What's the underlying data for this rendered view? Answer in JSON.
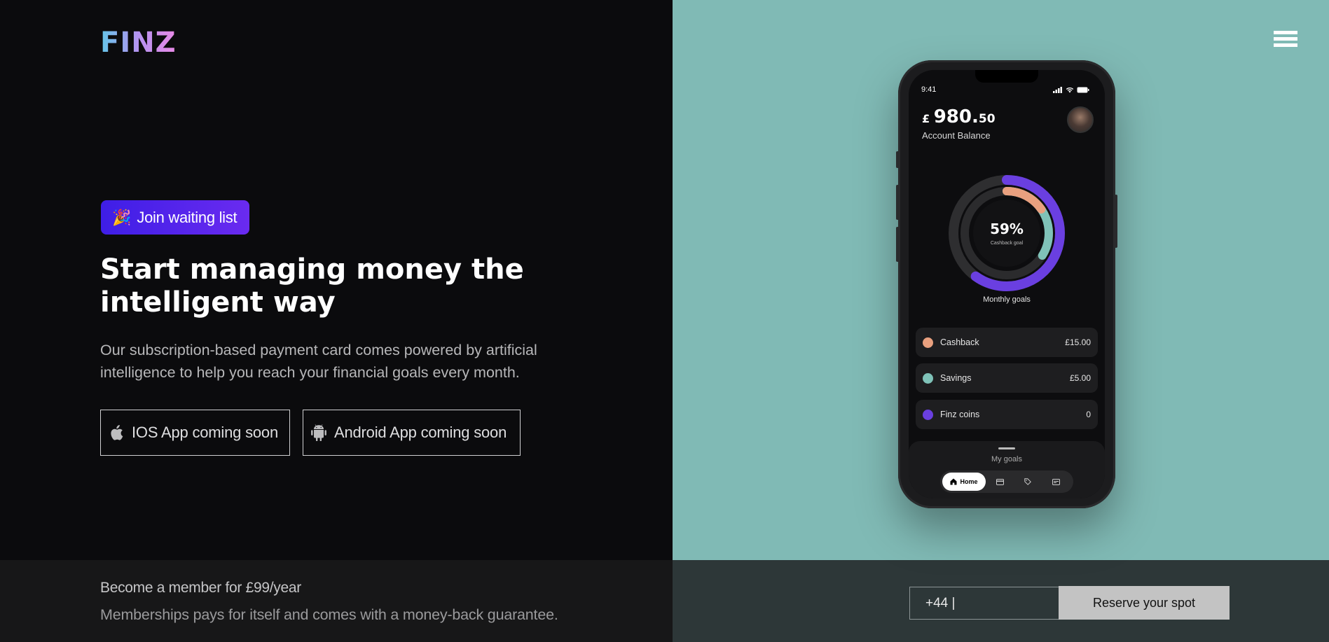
{
  "header": {
    "logo_text": "FINZ",
    "menu_icon": "hamburger-menu-icon"
  },
  "hero": {
    "waitlist_icon": "party-popper-icon",
    "waitlist_emoji": "🎉",
    "waitlist_label": "Join waiting list",
    "title": "Start managing money the intelligent way",
    "subtitle": "Our subscription-based payment card comes powered by artificial intelligence to help you reach your financial goals every month.",
    "ios_button": {
      "icon": "apple-icon",
      "label": "IOS App coming soon"
    },
    "android_button": {
      "icon": "android-icon",
      "label": "Android App coming soon"
    }
  },
  "footer": {
    "member_title": "Become a member for £99/year",
    "member_sub": "Memberships pays for itself and comes with a money-back guarantee.",
    "phone_input_value": "+44 |",
    "reserve_label": "Reserve your spot"
  },
  "phone": {
    "status_time": "9:41",
    "balance_currency": "£",
    "balance_main": "980.",
    "balance_decimal": "50",
    "balance_label": "Account Balance",
    "donut_percent": "59%",
    "donut_sub": "Cashback goal",
    "donut_caption": "Monthly goals",
    "goals": [
      {
        "name": "Cashback",
        "amount": "£15.00",
        "color": "#e9a07f"
      },
      {
        "name": "Savings",
        "amount": "£5.00",
        "color": "#7fc2b8"
      },
      {
        "name": "Finz coins",
        "amount": "0",
        "color": "#6a3fe0"
      }
    ],
    "sheet_title": "My goals",
    "tabs": {
      "home_label": "Home",
      "icons": [
        "card-icon",
        "tag-icon",
        "wallet-icon"
      ]
    }
  },
  "colors": {
    "left_bg": "#0b0b0d",
    "right_bg": "#80bab5",
    "accent_purple": "#4f24eb",
    "bottom_left_bg": "#171718",
    "bottom_right_bg": "#2d3738"
  }
}
